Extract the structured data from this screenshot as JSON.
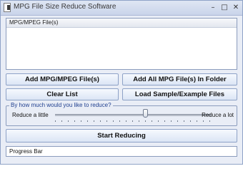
{
  "window": {
    "title": "MPG File Size Reduce Software",
    "controls": {
      "minimize": "–",
      "maximize": "□",
      "close": "✕"
    }
  },
  "file_list": {
    "column_header": "MPG/MPEG File(s)",
    "items": []
  },
  "buttons": {
    "add_files": "Add MPG/MPEG File(s)",
    "add_all_folder": "Add All MPG File(s) In Folder",
    "clear_list": "Clear List",
    "load_sample": "Load Sample/Example Files",
    "start": "Start Reducing"
  },
  "reduce_group": {
    "legend": "By how much would you like to reduce?",
    "min_label": "Reduce a little",
    "max_label": "Reduce a lot",
    "slider_value_fraction": 0.58
  },
  "progress": {
    "label": "Progress Bar",
    "value_fraction": 0.0
  },
  "colors": {
    "background": "#e9edf6",
    "border": "#8b9cbd",
    "legend_text": "#1f3f8f"
  },
  "icons": {
    "app": "document-icon"
  }
}
